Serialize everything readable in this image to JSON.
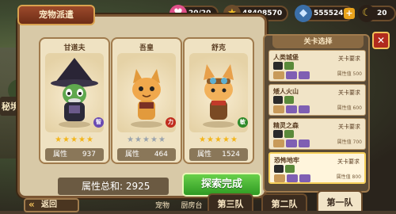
{
  "window_title": "宠物派遣",
  "resources": [
    {
      "icon": "heart-gem-icon",
      "value": "20/20",
      "color": "#e0508a"
    },
    {
      "icon": "star-icon",
      "value": "48408570",
      "color": "#f3c22a"
    },
    {
      "icon": "gem-icon",
      "value": "5555240",
      "color": "#7fb6f0"
    },
    {
      "icon": "moon-icon",
      "value": "20",
      "color": "#e8c23a"
    }
  ],
  "side_label": "秘境",
  "pets": [
    {
      "name": "甘道夫",
      "stars": "★★★★★",
      "attr_label": "属性",
      "attr_value": "937",
      "badge": "智",
      "badge_color": "#6a4bb3"
    },
    {
      "name": "吾皇",
      "stars": "★★★★★",
      "attr_label": "属性",
      "attr_value": "464",
      "badge": "力",
      "badge_color": "#c02c1e"
    },
    {
      "name": "舒克",
      "stars": "★★★★★",
      "attr_label": "属性",
      "attr_value": "1524",
      "badge": "敏",
      "badge_color": "#2f8a2a"
    }
  ],
  "total": {
    "label": "属性总和:",
    "value": "2925"
  },
  "explore_button": "探索完成",
  "level_panel": {
    "title": "关卡选择",
    "levels": [
      {
        "name": "人类城堡",
        "req": "关卡要求",
        "attr": "属性值 500"
      },
      {
        "name": "矮人火山",
        "req": "关卡要求",
        "attr": "属性值 600"
      },
      {
        "name": "精灵之森",
        "req": "关卡要求",
        "attr": "属性值 700"
      },
      {
        "name": "恐怖地牢",
        "req": "关卡要求",
        "attr": "属性值 800"
      }
    ]
  },
  "back_button": "返回",
  "tabs": [
    {
      "label": "第三队"
    },
    {
      "label": "第二队"
    },
    {
      "label": "第一队"
    }
  ],
  "dock": [
    "宠物",
    "厨房台"
  ],
  "close_label": "✕"
}
